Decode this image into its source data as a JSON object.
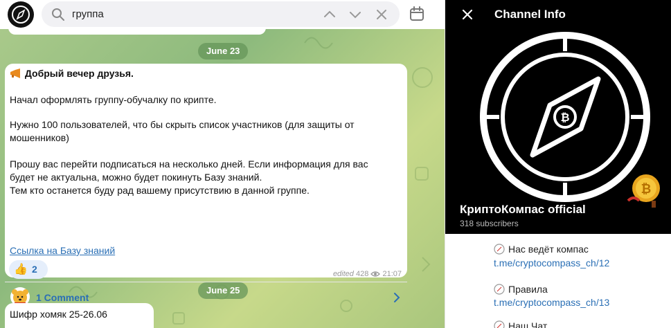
{
  "search": {
    "query": "группа"
  },
  "chat": {
    "dates": [
      "June 23",
      "June 25"
    ],
    "message1": {
      "lines": [
        "Добрый вечер друзья.",
        "Начал оформлять группу-обучалку по крипте.",
        "Нужно 100 пользователей, что бы скрыть список участников (для защиты от",
        "мошенников)",
        "Прошу вас перейти подписаться на несколько дней. Если информация для вас",
        "будет не актуальна, можно будет покинуть Базу знаний.",
        "Тем кто останется буду рад вашему присутствию в данной группе."
      ],
      "link": "Ссылка на Базу знаний",
      "reaction_emoji": "👍",
      "reaction_count": "2",
      "edited_label": "edited",
      "views": "428",
      "time": "21:07",
      "comments_label": "1 Comment"
    },
    "message2": {
      "text": "Шифр хомяк 25-26.06"
    }
  },
  "panel": {
    "title": "Channel Info",
    "channel_name": "КриптоКомпас official",
    "subscribers": "318 subscribers",
    "items": [
      {
        "label": "Нас ведёт компас",
        "link": "t.me/cryptocompass_ch/12"
      },
      {
        "label": "Правила",
        "link": "t.me/cryptocompass_ch/13"
      },
      {
        "label": "Наш Чат",
        "link": ""
      }
    ]
  },
  "icons": {
    "search": "search-icon",
    "up": "chevron-up-icon",
    "down": "chevron-down-icon",
    "clear": "close-icon",
    "calendar": "calendar-icon",
    "eye": "eye-icon",
    "chevron": "chevron-right-icon",
    "compass": "compass-icon"
  },
  "colors": {
    "accent": "#2a6fb5",
    "date_pill": "#66965a",
    "panel_header": "#000000"
  }
}
